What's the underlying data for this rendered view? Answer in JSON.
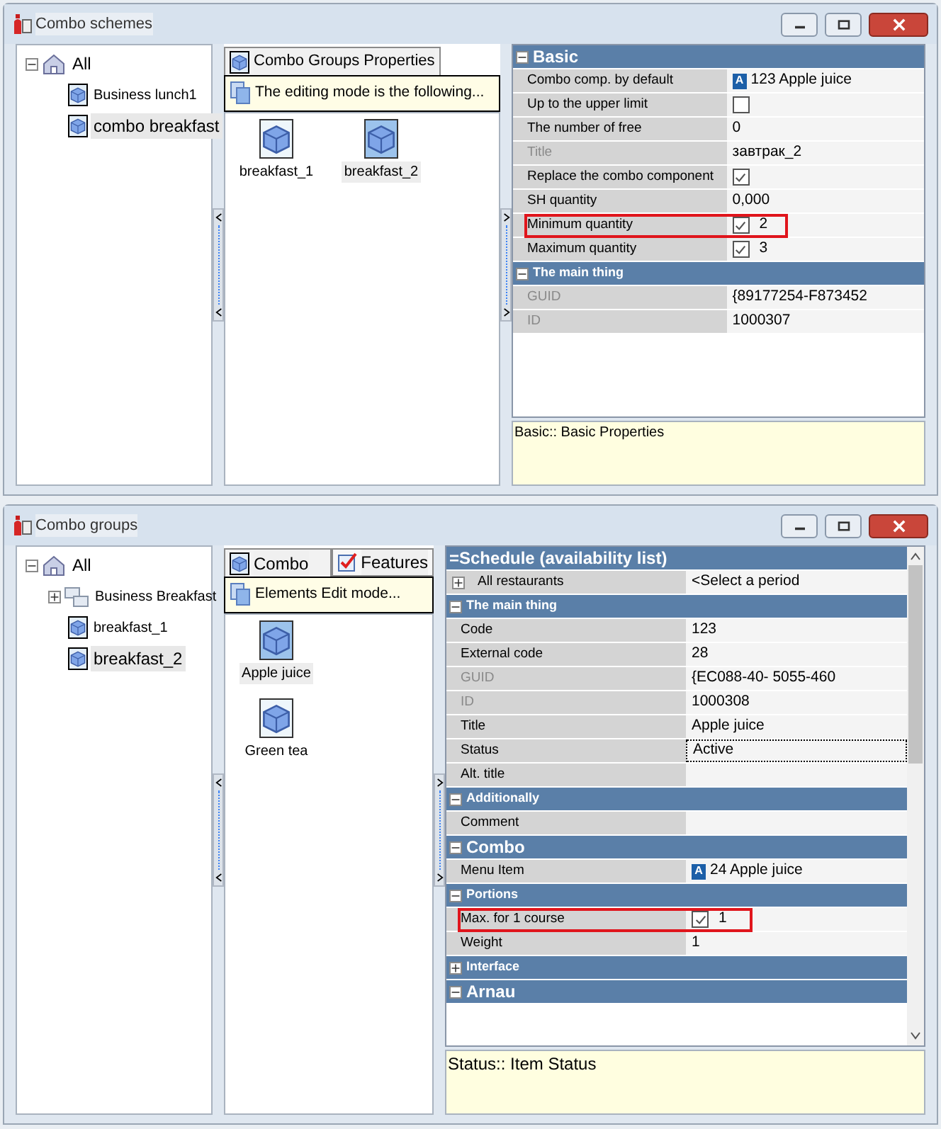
{
  "windows": [
    {
      "title": "Combo schemes",
      "tree": [
        {
          "label": "All",
          "expanded": true,
          "selected": false,
          "kind": "root",
          "children": [
            {
              "label": "Business lunch1",
              "selected": false,
              "kind": "item"
            },
            {
              "label": "combo breakfast",
              "selected": true,
              "kind": "item"
            }
          ]
        }
      ],
      "tabs": [
        {
          "label": "Combo Groups Properties",
          "selected": true,
          "kind": "combo"
        }
      ],
      "hint": "The editing mode is the following...",
      "tiles": [
        {
          "label": "breakfast_1",
          "selected": false
        },
        {
          "label": "breakfast_2",
          "selected": true
        }
      ],
      "properties": [
        {
          "kind": "section",
          "label": "Basic",
          "expanded": true
        },
        {
          "kind": "prop",
          "label": "Combo comp. by default",
          "value": "123 Apple juice",
          "badge": "A",
          "disabled": false,
          "highlighted": false
        },
        {
          "kind": "prop",
          "label": "Up to the upper limit",
          "checked": false,
          "disabled": false,
          "highlighted": false
        },
        {
          "kind": "prop",
          "label": "The number of free",
          "value": "0",
          "disabled": false,
          "highlighted": false
        },
        {
          "kind": "prop",
          "label": "Title",
          "value": "завтрак_2",
          "disabled": true,
          "highlighted": false
        },
        {
          "kind": "prop",
          "label": "Replace the combo component",
          "checked": true,
          "disabled": false,
          "highlighted": false
        },
        {
          "kind": "prop",
          "label": "SH quantity",
          "value": "0,000",
          "disabled": false,
          "highlighted": false
        },
        {
          "kind": "prop",
          "label": "Minimum quantity",
          "value": "2",
          "checked": true,
          "disabled": false,
          "highlighted": true
        },
        {
          "kind": "prop",
          "label": "Maximum quantity",
          "value": "3",
          "checked": true,
          "disabled": false,
          "highlighted": false
        },
        {
          "kind": "section",
          "label": "The main thing",
          "expanded": true
        },
        {
          "kind": "prop",
          "label": "GUID",
          "value": "{89177254-F873452",
          "disabled": true,
          "highlighted": false
        },
        {
          "kind": "prop",
          "label": "ID",
          "value": "1000307",
          "disabled": true,
          "highlighted": false
        }
      ],
      "description": "Basic:: Basic Properties"
    },
    {
      "title": "Combo groups",
      "tree": [
        {
          "label": "All",
          "expanded": true,
          "selected": false,
          "kind": "root",
          "children": [
            {
              "label": "Business Breakfast",
              "expanded": false,
              "selected": false,
              "kind": "folder"
            },
            {
              "label": "breakfast_1",
              "selected": false,
              "kind": "item"
            },
            {
              "label": "breakfast_2",
              "selected": true,
              "kind": "item"
            }
          ]
        }
      ],
      "tabs": [
        {
          "label": "Combo",
          "selected": true,
          "kind": "combo"
        },
        {
          "label": "Features",
          "selected": false,
          "kind": "features"
        }
      ],
      "hint": "Elements Edit mode...",
      "tiles": [
        {
          "label": "Apple juice",
          "selected": true
        },
        {
          "label": "Green tea",
          "selected": false
        }
      ],
      "properties": [
        {
          "kind": "section",
          "label": "=Schedule (availability list)"
        },
        {
          "kind": "group",
          "label": "All restaurants",
          "value": "<Select a period",
          "expanded": false,
          "disabled": false,
          "highlighted": false
        },
        {
          "kind": "section",
          "label": "The main thing",
          "expanded": true
        },
        {
          "kind": "prop",
          "label": "Code",
          "value": "123",
          "disabled": false,
          "highlighted": false
        },
        {
          "kind": "prop",
          "label": "External code",
          "value": "28",
          "disabled": false,
          "highlighted": false
        },
        {
          "kind": "prop",
          "label": "GUID",
          "value": "{EC088-40- 5055-460",
          "disabled": true,
          "highlighted": false
        },
        {
          "kind": "prop",
          "label": "ID",
          "value": "1000308",
          "disabled": true,
          "highlighted": false
        },
        {
          "kind": "prop",
          "label": "Title",
          "value": "Apple juice",
          "disabled": false,
          "highlighted": false
        },
        {
          "kind": "prop",
          "label": "Status",
          "value": "Active",
          "disabled": false,
          "highlighted": false,
          "focused": true
        },
        {
          "kind": "prop",
          "label": "Alt. title",
          "disabled": false,
          "highlighted": false
        },
        {
          "kind": "section",
          "label": "Additionally",
          "expanded": true
        },
        {
          "kind": "prop",
          "label": "Comment",
          "disabled": false,
          "highlighted": false
        },
        {
          "kind": "section",
          "label": "Combo",
          "expanded": true
        },
        {
          "kind": "prop",
          "label": "Menu Item",
          "value": "24 Apple juice",
          "badge": "A",
          "disabled": false,
          "highlighted": false
        },
        {
          "kind": "section",
          "label": "Portions",
          "expanded": true
        },
        {
          "kind": "prop",
          "label": "Max. for 1 course",
          "value": "1",
          "checked": true,
          "disabled": false,
          "highlighted": true
        },
        {
          "kind": "prop",
          "label": "Weight",
          "value": "1",
          "disabled": false,
          "highlighted": false
        },
        {
          "kind": "section",
          "label": "Interface",
          "expanded": false
        },
        {
          "kind": "section",
          "label": "Arnau",
          "expanded": true
        }
      ],
      "description": "Status:: Item Status"
    }
  ]
}
